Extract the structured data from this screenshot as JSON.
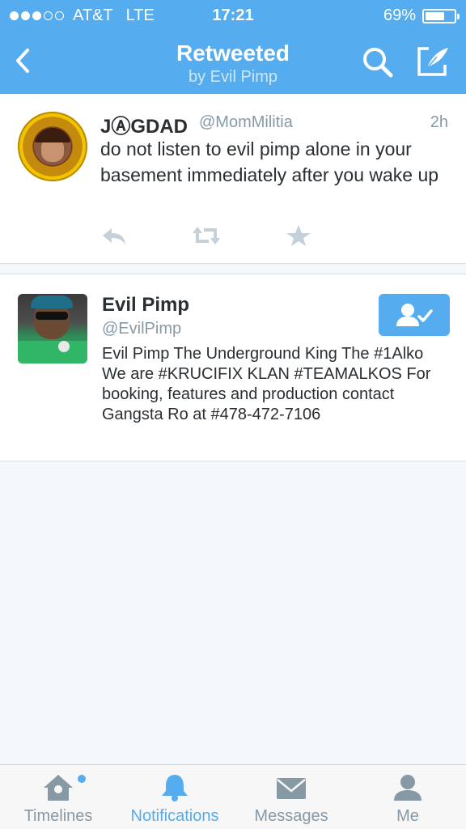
{
  "status_bar": {
    "carrier": "AT&T",
    "network": "LTE",
    "time": "17:21",
    "battery": "69%",
    "battery_level": 0.69,
    "signal_bars": 3,
    "signal_total": 5
  },
  "nav": {
    "title": "Retweeted",
    "subtitle": "by Evil Pimp",
    "back_icon": "chevron-left-icon",
    "search_icon": "search-icon",
    "compose_icon": "compose-icon"
  },
  "tweet": {
    "name": "JⒶGDAD",
    "handle": "@MomMilitia",
    "timestamp": "2h",
    "text": "do not listen to evil pimp alone in your basement immediately after you wake up",
    "actions": [
      "reply-icon",
      "retweet-icon",
      "favorite-icon"
    ]
  },
  "user_card": {
    "name": "Evil Pimp",
    "handle": "@EvilPimp",
    "bio": "Evil Pimp The Underground King The #1Alko We are #KRUCIFIX KLAN #TEAMALKOS For booking, features and production contact Gangsta Ro at #478-472-7106",
    "follow_icon": "following-user-icon"
  },
  "tabbar": {
    "tabs": [
      {
        "label": "Timelines",
        "icon": "home-icon",
        "active": false,
        "has_dot": true
      },
      {
        "label": "Notifications",
        "icon": "bell-icon",
        "active": true,
        "has_dot": false
      },
      {
        "label": "Messages",
        "icon": "envelope-icon",
        "active": false,
        "has_dot": false
      },
      {
        "label": "Me",
        "icon": "person-icon",
        "active": false,
        "has_dot": false
      }
    ]
  },
  "colors": {
    "brand": "#55acee",
    "text": "#292f33",
    "muted": "#8899a6",
    "icon_gray": "#aab8c2"
  }
}
